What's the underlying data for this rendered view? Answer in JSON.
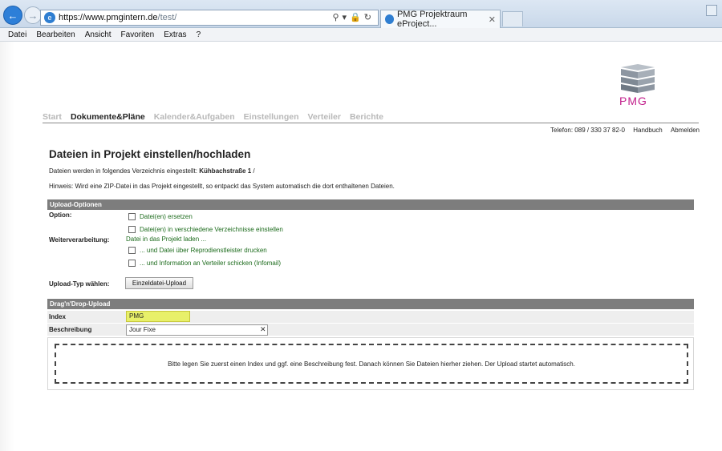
{
  "browser": {
    "url_host": "https://www.pmgintern.de",
    "url_path": "/test/",
    "tab_title": "PMG Projektraum eProject...",
    "favicon_letter": "e"
  },
  "menubar": [
    "Datei",
    "Bearbeiten",
    "Ansicht",
    "Favoriten",
    "Extras",
    "?"
  ],
  "logo": {
    "brand": "PMG"
  },
  "nav": [
    "Start",
    "Dokumente&Pläne",
    "Kalender&Aufgaben",
    "Einstellungen",
    "Verteiler",
    "Berichte"
  ],
  "topright": {
    "phone": "Telefon: 089 / 330 37 82-0",
    "handbook": "Handbuch",
    "logout": "Abmelden"
  },
  "page": {
    "title": "Dateien in Projekt einstellen/hochladen",
    "info_prefix": "Dateien werden in folgendes Verzeichnis eingestellt:",
    "info_folder": "Kühbachstraße 1",
    "info_suffix": "/",
    "hint": "Hinweis: Wird eine ZIP-Datei in das Projekt eingestellt, so entpackt das System automatisch die dort enthaltenen Dateien."
  },
  "upload_options": {
    "header": "Upload-Optionen",
    "option_label": "Option:",
    "replace": "Datei(en) ersetzen",
    "multi_dir": "Datei(en) in verschiedene Verzeichnisse einstellen",
    "further_label": "Weiterverarbeitung:",
    "load_text": "Datei in das Projekt laden ...",
    "print": "... und Datei über Reprodienstleister drucken",
    "infomail": "... und Information an Verteiler schicken (Infomail)",
    "type_label": "Upload-Typ wählen:",
    "type_button": "Einzeldatei-Upload"
  },
  "dragdrop": {
    "header": "Drag'n'Drop-Upload",
    "index_label": "Index",
    "index_value": "PMG",
    "desc_label": "Beschreibung",
    "desc_value": "Jour Fixe",
    "clear": "✕",
    "instruction": "Bitte legen Sie zuerst einen Index und ggf. eine Beschreibung fest. Danach können Sie Dateien hierher ziehen. Der Upload startet automatisch."
  }
}
